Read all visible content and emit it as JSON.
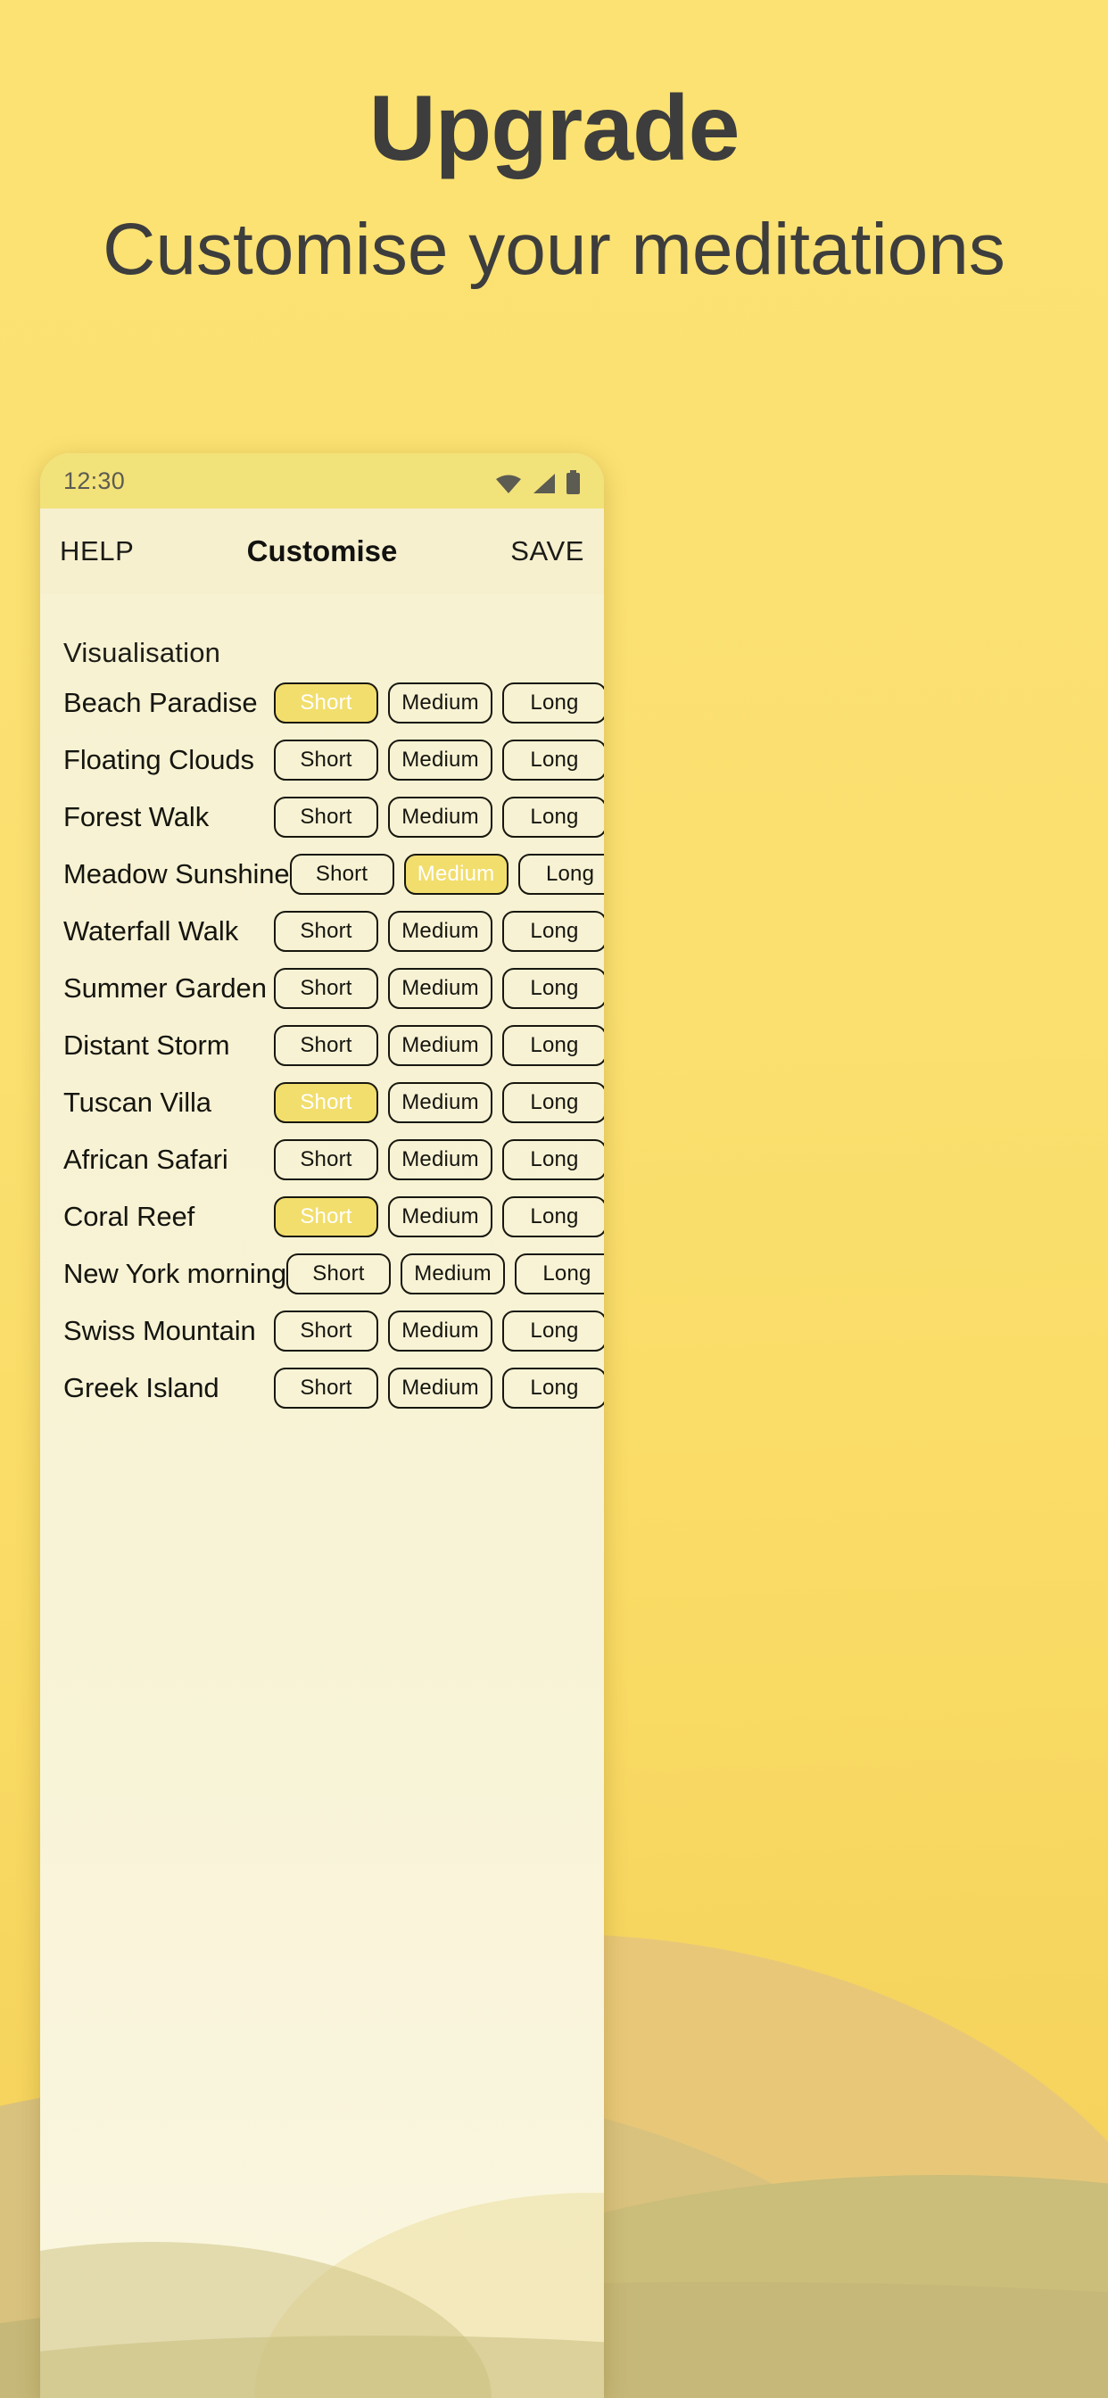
{
  "marketing": {
    "headline": "Upgrade",
    "subhead": "Customise your meditations"
  },
  "colors": {
    "page_background": "#fbe272",
    "accent_yellow": "#f2de6c",
    "text_dark": "#3d3d3d",
    "app_background": "#f7f2d4",
    "statusbar": "#f2e27a",
    "hill_1": "#e8c878",
    "hill_2": "#d9c27e",
    "hill_3": "#cbbd7a"
  },
  "phone": {
    "statusbar": {
      "time": "12:30",
      "icons": [
        "wifi-icon",
        "cellular-signal-icon",
        "battery-icon"
      ]
    },
    "appbar": {
      "help_label": "HELP",
      "title": "Customise",
      "save_label": "SAVE"
    },
    "section_label": "Visualisation",
    "options": [
      "Short",
      "Medium",
      "Long"
    ],
    "rows": [
      {
        "name": "Beach Paradise",
        "selected": "Short"
      },
      {
        "name": "Floating Clouds",
        "selected": null
      },
      {
        "name": "Forest Walk",
        "selected": null
      },
      {
        "name": "Meadow Sunshine",
        "selected": "Medium"
      },
      {
        "name": "Waterfall Walk",
        "selected": null
      },
      {
        "name": "Summer Garden",
        "selected": null
      },
      {
        "name": "Distant Storm",
        "selected": null
      },
      {
        "name": "Tuscan Villa",
        "selected": "Short"
      },
      {
        "name": "African Safari",
        "selected": null
      },
      {
        "name": "Coral Reef",
        "selected": "Short"
      },
      {
        "name": "New York morning",
        "selected": null
      },
      {
        "name": "Swiss Mountain",
        "selected": null
      },
      {
        "name": "Greek Island",
        "selected": null
      }
    ]
  }
}
